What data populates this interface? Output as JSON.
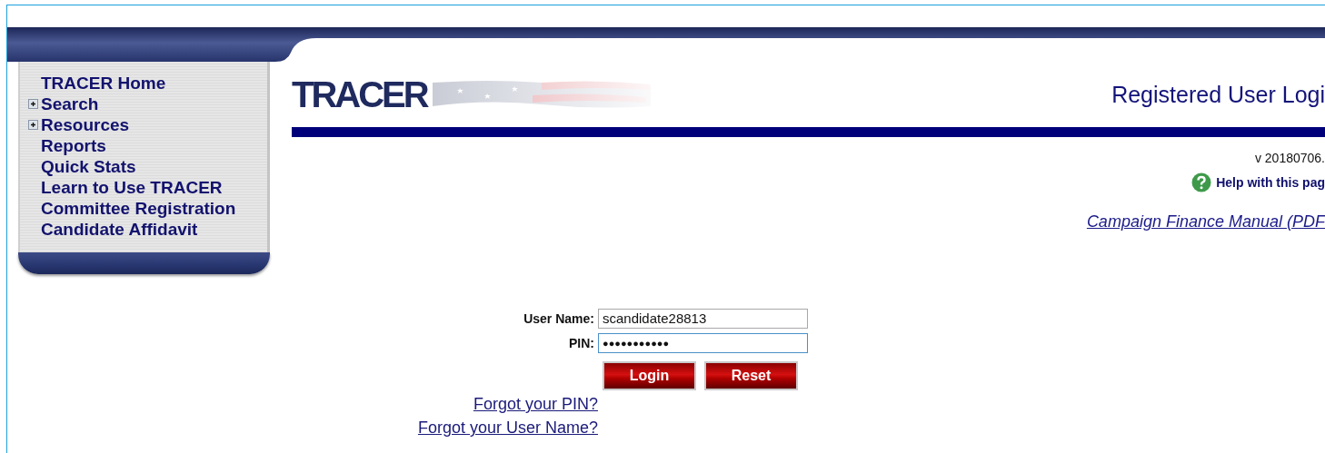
{
  "sidebar": {
    "items": [
      {
        "label": "TRACER Home",
        "kind": "link"
      },
      {
        "label": "Search",
        "kind": "expandable"
      },
      {
        "label": "Resources",
        "kind": "expandable"
      },
      {
        "label": "Reports",
        "kind": "link"
      },
      {
        "label": "Quick Stats",
        "kind": "link"
      },
      {
        "label": "Learn to Use TRACER",
        "kind": "link"
      },
      {
        "label": "Committee Registration",
        "kind": "link"
      },
      {
        "label": "Candidate Affidavit",
        "kind": "link"
      }
    ]
  },
  "logo": {
    "text": "TRACER"
  },
  "page_title": "Registered User Logi",
  "version": "v 20180706.",
  "help_link": "Help with this pag",
  "manual_link": "Campaign Finance Manual (PDF",
  "form": {
    "fields": [
      {
        "label": "User Name:",
        "value": "scandidate28813",
        "focused": false
      },
      {
        "label": "PIN:",
        "value": "●●●●●●●●●●●",
        "focused": true
      }
    ],
    "buttons": [
      "Login",
      "Reset"
    ],
    "links": [
      "Forgot your PIN?",
      "Forgot your User Name?"
    ]
  }
}
